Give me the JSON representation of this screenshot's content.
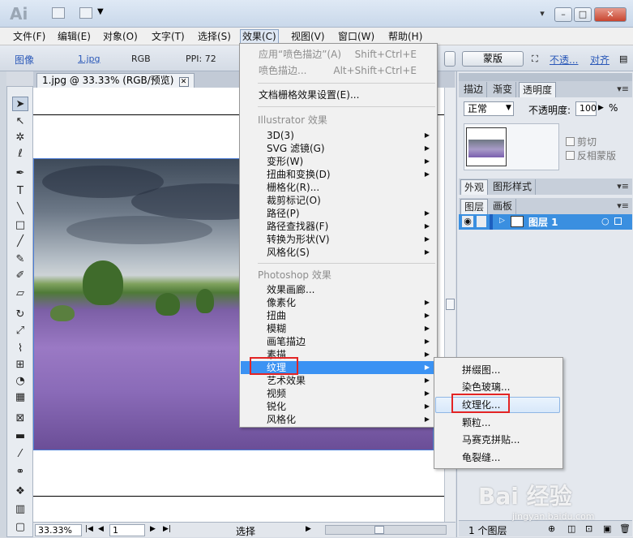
{
  "titlebar": {
    "app_logo": "Ai",
    "icons": [
      "bridge-icon",
      "arrange-documents-icon"
    ],
    "window_buttons": [
      "▾",
      "–",
      "□",
      "✕"
    ]
  },
  "menubar": [
    "文件(F)",
    "编辑(E)",
    "对象(O)",
    "文字(T)",
    "选择(S)",
    "效果(C)",
    "视图(V)",
    "窗口(W)",
    "帮助(H)"
  ],
  "controlbar": {
    "type": "图像",
    "filename": "1.jpg",
    "mode": "RGB",
    "ppi": "PPI: 72",
    "button": "蒙版",
    "link1": "不透...",
    "link2": "对齐"
  },
  "document": {
    "tab_title": "1.jpg @ 33.33% (RGB/预览)",
    "close": "✕"
  },
  "statusbar": {
    "zoom": "33.33%",
    "artboard": "1",
    "tool": "选择"
  },
  "transparency_panel": {
    "tabs": [
      "描边",
      "渐变",
      "透明度"
    ],
    "blend_mode": "正常",
    "opacity_label": "不透明度:",
    "opacity_value": "100",
    "clip": "剪切",
    "invert_mask": "反相蒙版"
  },
  "appearance_panel": {
    "tabs": [
      "外观",
      "图形样式"
    ]
  },
  "layers_panel": {
    "tabs": [
      "图层",
      "画板"
    ],
    "layer_name": "图层 1",
    "footer": "1 个图层"
  },
  "effect_menu": {
    "apply_last": "应用“喷色描边”(A)",
    "apply_last_shortcut": "Shift+Ctrl+E",
    "last_effect": "喷色描边...",
    "last_effect_shortcut": "Alt+Shift+Ctrl+E",
    "raster_settings": "文档栅格效果设置(E)...",
    "illustrator_header": "Illustrator 效果",
    "illustrator_items": [
      "3D(3)",
      "SVG 滤镜(G)",
      "变形(W)",
      "扭曲和变换(D)",
      "栅格化(R)...",
      "裁剪标记(O)",
      "路径(P)",
      "路径查找器(F)",
      "转换为形状(V)",
      "风格化(S)"
    ],
    "photoshop_header": "Photoshop 效果",
    "photoshop_items": [
      "效果画廊...",
      "像素化",
      "扭曲",
      "模糊",
      "画笔描边",
      "素描",
      "纹理",
      "艺术效果",
      "视频",
      "锐化",
      "风格化"
    ]
  },
  "texture_submenu": [
    "拼缀图...",
    "染色玻璃...",
    "纹理化...",
    "颗粒...",
    "马赛克拼贴...",
    "龟裂缝..."
  ],
  "watermark": {
    "brand": "Bai 经验",
    "url": "jingyan.baidu.com"
  }
}
